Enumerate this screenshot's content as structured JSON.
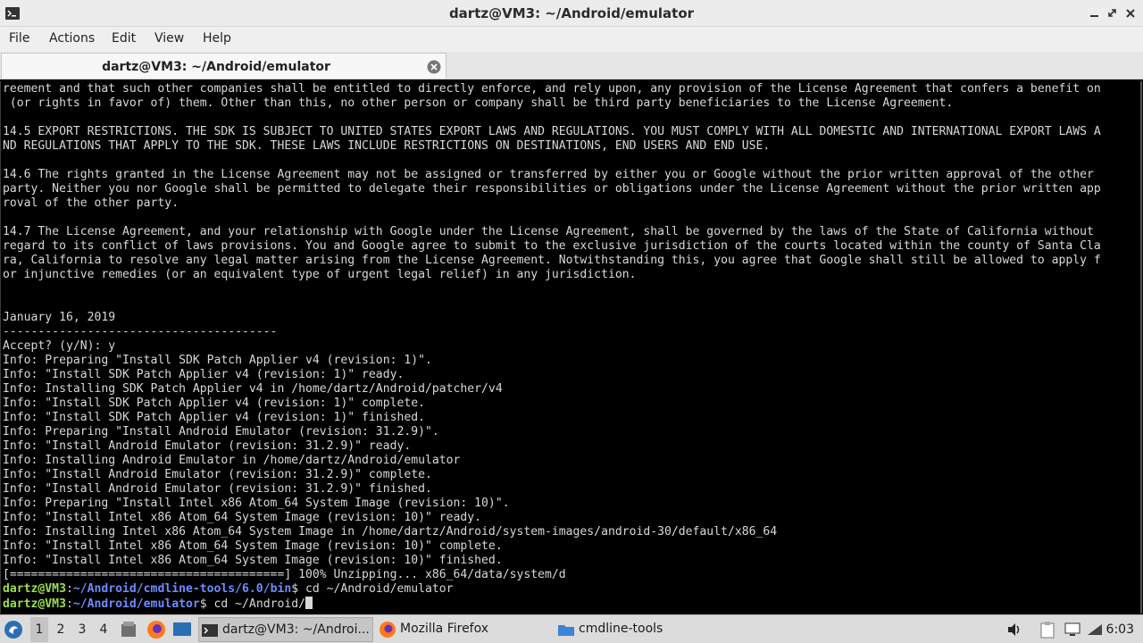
{
  "window": {
    "title": "dartz@VM3: ~/Android/emulator"
  },
  "menu": {
    "items": [
      "File",
      "Actions",
      "Edit",
      "View",
      "Help"
    ]
  },
  "tab": {
    "label": "dartz@VM3: ~/Android/emulator"
  },
  "terminal": {
    "lines": [
      "reement and that such other companies shall be entitled to directly enforce, and rely upon, any provision of the License Agreement that confers a benefit on",
      " (or rights in favor of) them. Other than this, no other person or company shall be third party beneficiaries to the License Agreement.",
      "",
      "14.5 EXPORT RESTRICTIONS. THE SDK IS SUBJECT TO UNITED STATES EXPORT LAWS AND REGULATIONS. YOU MUST COMPLY WITH ALL DOMESTIC AND INTERNATIONAL EXPORT LAWS A",
      "ND REGULATIONS THAT APPLY TO THE SDK. THESE LAWS INCLUDE RESTRICTIONS ON DESTINATIONS, END USERS AND END USE.",
      "",
      "14.6 The rights granted in the License Agreement may not be assigned or transferred by either you or Google without the prior written approval of the other",
      "party. Neither you nor Google shall be permitted to delegate their responsibilities or obligations under the License Agreement without the prior written app",
      "roval of the other party.",
      "",
      "14.7 The License Agreement, and your relationship with Google under the License Agreement, shall be governed by the laws of the State of California without",
      "regard to its conflict of laws provisions. You and Google agree to submit to the exclusive jurisdiction of the courts located within the county of Santa Cla",
      "ra, California to resolve any legal matter arising from the License Agreement. Notwithstanding this, you agree that Google shall still be allowed to apply f",
      "or injunctive remedies (or an equivalent type of urgent legal relief) in any jurisdiction.",
      "",
      "",
      "January 16, 2019",
      "---------------------------------------",
      "Accept? (y/N): y",
      "Info: Preparing \"Install SDK Patch Applier v4 (revision: 1)\".",
      "Info: \"Install SDK Patch Applier v4 (revision: 1)\" ready.",
      "Info: Installing SDK Patch Applier v4 in /home/dartz/Android/patcher/v4",
      "Info: \"Install SDK Patch Applier v4 (revision: 1)\" complete.",
      "Info: \"Install SDK Patch Applier v4 (revision: 1)\" finished.",
      "Info: Preparing \"Install Android Emulator (revision: 31.2.9)\".",
      "Info: \"Install Android Emulator (revision: 31.2.9)\" ready.",
      "Info: Installing Android Emulator in /home/dartz/Android/emulator",
      "Info: \"Install Android Emulator (revision: 31.2.9)\" complete.",
      "Info: \"Install Android Emulator (revision: 31.2.9)\" finished.",
      "Info: Preparing \"Install Intel x86 Atom_64 System Image (revision: 10)\".",
      "Info: \"Install Intel x86 Atom_64 System Image (revision: 10)\" ready.",
      "Info: Installing Intel x86 Atom_64 System Image in /home/dartz/Android/system-images/android-30/default/x86_64",
      "Info: \"Install Intel x86 Atom_64 System Image (revision: 10)\" complete.",
      "Info: \"Install Intel x86 Atom_64 System Image (revision: 10)\" finished.",
      "[=======================================] 100% Unzipping... x86_64/data/system/d"
    ],
    "prompts": [
      {
        "user": "dartz@VM3",
        "sep": ":",
        "path": "~/Android/cmdline-tools/6.0/bin",
        "cmd": "$ cd ~/Android/emulator"
      },
      {
        "user": "dartz@VM3",
        "sep": ":",
        "path": "~/Android/emulator",
        "cmd": "$ cd ~/Android/"
      }
    ]
  },
  "taskbar": {
    "workspaces": [
      "1",
      "2",
      "3",
      "4"
    ],
    "tasks": [
      {
        "label": "dartz@VM3: ~/Androi...",
        "icon": "terminal-icon"
      },
      {
        "label": "Mozilla Firefox",
        "icon": "firefox-icon"
      },
      {
        "label": "cmdline-tools",
        "icon": "folder-icon"
      }
    ],
    "clock": "6:03"
  }
}
